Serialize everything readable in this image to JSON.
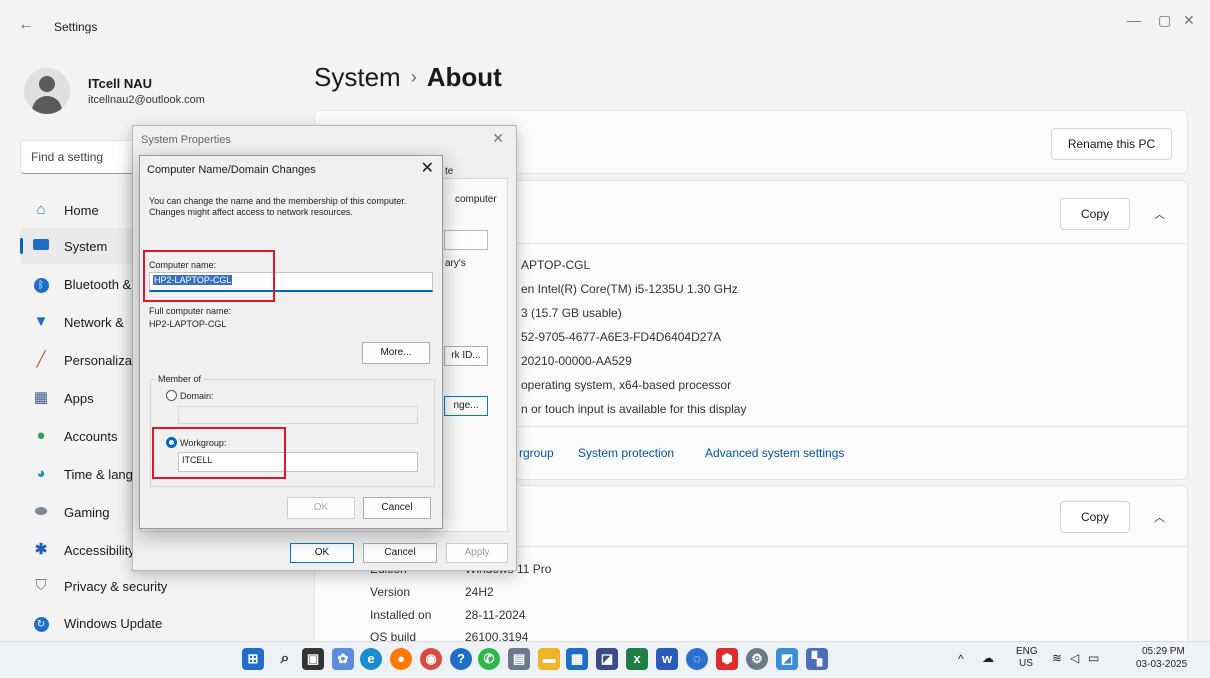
{
  "window": {
    "title": "Settings",
    "controls": [
      "—",
      "▢",
      "✕"
    ]
  },
  "profile": {
    "name": "ITcell NAU",
    "email": "itcellnau2@outlook.com"
  },
  "search": {
    "placeholder": "Find a setting"
  },
  "sidebar": {
    "items": [
      {
        "label": "Home",
        "icon": "home-icon"
      },
      {
        "label": "System",
        "icon": "display-icon"
      },
      {
        "label": "Bluetooth &",
        "icon": "bluetooth-icon"
      },
      {
        "label": "Network &",
        "icon": "wifi-icon"
      },
      {
        "label": "Personalizat",
        "icon": "brush-icon"
      },
      {
        "label": "Apps",
        "icon": "apps-icon"
      },
      {
        "label": "Accounts",
        "icon": "person-icon"
      },
      {
        "label": "Time & lang",
        "icon": "globe-icon"
      },
      {
        "label": "Gaming",
        "icon": "controller-icon"
      },
      {
        "label": "Accessibility",
        "icon": "accessibility-icon"
      },
      {
        "label": "Privacy & security",
        "icon": "shield-icon"
      },
      {
        "label": "Windows Update",
        "icon": "update-icon"
      }
    ]
  },
  "breadcrumb": {
    "parent": "System",
    "separator": "›",
    "current": "About"
  },
  "rename_button": "Rename this PC",
  "device_specs": {
    "copy_label": "Copy",
    "values": [
      "APTOP-CGL",
      "en Intel(R) Core(TM) i5-1235U   1.30 GHz",
      "3 (15.7 GB usable)",
      "52-9705-4677-A6E3-FD4D6404D27A",
      "20210-00000-AA529",
      "operating system, x64-based processor",
      "n or touch input is available for this display"
    ]
  },
  "related_links": [
    "rgroup",
    "System protection",
    "Advanced system settings"
  ],
  "windows_specs": {
    "copy_label": "Copy",
    "rows": [
      {
        "label": "Edition",
        "value": "Windows 11 Pro"
      },
      {
        "label": "Version",
        "value": "24H2"
      },
      {
        "label": "Installed on",
        "value": "28-11-2024"
      },
      {
        "label": "OS build",
        "value": "26100.3194"
      }
    ]
  },
  "system_properties": {
    "title": "System Properties",
    "close": "✕",
    "tab_fragment": "te",
    "text_computer": "computer",
    "text_arys": "ary's",
    "network_id_button": "rk ID...",
    "change_button": "nge...",
    "ok": "OK",
    "cancel": "Cancel",
    "apply": "Apply"
  },
  "computer_name_dialog": {
    "title": "Computer Name/Domain Changes",
    "close": "✕",
    "description": "You can change the name and the membership of this computer. Changes might affect access to network resources.",
    "computer_name_label": "Computer name:",
    "computer_name_value": "HP2-LAPTOP-CGL",
    "full_name_label": "Full computer name:",
    "full_name_value": "HP2-LAPTOP-CGL",
    "more_button": "More...",
    "member_of_label": "Member of",
    "domain_label": "Domain:",
    "workgroup_label": "Workgroup:",
    "workgroup_value": "ITCELL",
    "ok": "OK",
    "cancel": "Cancel"
  },
  "taskbar": {
    "language": "ENG",
    "region": "US",
    "time": "05:29 PM",
    "date": "03-03-2025"
  }
}
